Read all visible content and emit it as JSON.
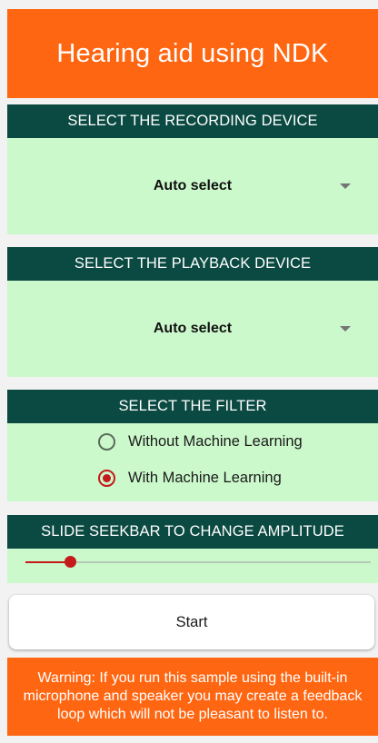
{
  "app_bar": {
    "title": "Hearing aid using NDK"
  },
  "recording": {
    "header": "SELECT THE RECORDING DEVICE",
    "selected": "Auto select"
  },
  "playback": {
    "header": "SELECT THE PLAYBACK DEVICE",
    "selected": "Auto select"
  },
  "filter": {
    "header": "SELECT THE FILTER",
    "options": [
      {
        "label": "Without Machine Learning",
        "checked": false
      },
      {
        "label": "With Machine Learning",
        "checked": true
      }
    ]
  },
  "amplitude": {
    "header": "SLIDE SEEKBAR TO CHANGE AMPLITUDE",
    "value_fraction": 0.13
  },
  "start_button": {
    "label": "Start"
  },
  "warning": {
    "text": "Warning: If you run this sample using the built-in microphone and speaker you may create a feedback loop which will not be pleasant to listen to."
  },
  "colors": {
    "accent": "#ff6612",
    "header_bg": "#0b4a42",
    "panel_bg": "#ccf9cc",
    "control_red": "#c41a1a"
  },
  "icons": {
    "dropdown": "caret-down-icon",
    "radio_off": "radio-unchecked-icon",
    "radio_on": "radio-checked-icon"
  }
}
